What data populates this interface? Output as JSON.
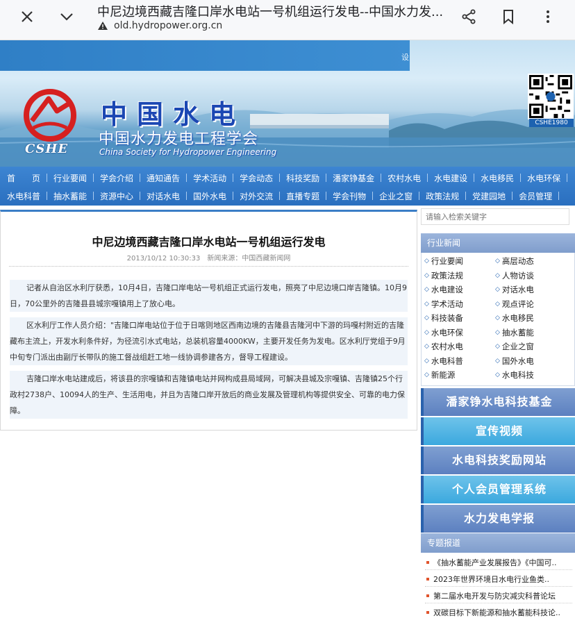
{
  "browser": {
    "title": "中尼边境西藏吉隆口岸水电站一号机组运行发电--中国水力发...",
    "url": "old.hydropower.org.cn"
  },
  "banner": {
    "strip_text": "设",
    "title_big": "中国水电",
    "title_sub": "中国水力发电工程学会",
    "title_en": "China Society for Hydropower Engineering",
    "logo_text": "CSHE",
    "qr_label": "CSHE1980"
  },
  "nav": {
    "row1": [
      "首　　页",
      "行业要闻",
      "学会介绍",
      "通知通告",
      "学术活动",
      "学会动态",
      "科技奖励",
      "潘家铮基金",
      "农村水电",
      "水电建设",
      "水电移民",
      "水电环保"
    ],
    "row2": [
      "水电科普",
      "抽水蓄能",
      "资源中心",
      "对话水电",
      "国外水电",
      "对外交流",
      "直播专题",
      "学会刊物",
      "企业之窗",
      "政策法规",
      "党建园地",
      "会员管理"
    ]
  },
  "article": {
    "title": "中尼边境西藏吉隆口岸水电站一号机组运行发电",
    "date": "2013/10/12 10:30:33",
    "source": "新闻来源：中国西藏新闻网",
    "paragraphs": [
      "记者从自治区水利厅获悉，10月4日，吉隆口岸电站一号机组正式运行发电，照亮了中尼边境口岸吉隆镇。10月9日，70公里外的吉隆县县城宗嘎镇用上了放心电。",
      "区水利厅工作人员介绍：\"吉隆口岸电站位于位于日喀则地区西南边境的吉隆县吉隆河中下游的玛嘎村附近的吉隆藏布主流上，开发水利条件好，为径流引水式电站，总装机容量4000KW，主要开发任务为发电。区水利厅党组于9月中旬专门派出由副厅长带队的施工督战组赶工地一线协调参建各方，督导工程建设。",
      "吉隆口岸水电站建成后，将该县的宗嘎镇和吉隆镇电站并网构成县局域网，可解决县城及宗嘎镇、吉隆镇25个行政村2738户、10094人的生产、生活用电，并且为吉隆口岸开放后的商业发展及管理机构等提供安全、可靠的电力保障。"
    ]
  },
  "sidebar": {
    "search_placeholder": "请输入检索关键字",
    "news_header": "行业新闻",
    "news_left": [
      "行业要闻",
      "政策法规",
      "水电建设",
      "学术活动",
      "科技装备",
      "水电环保",
      "农村水电",
      "水电科普",
      "新能源"
    ],
    "news_right": [
      "高层动态",
      "人物访谈",
      "对话水电",
      "观点评论",
      "水电移民",
      "抽水蓄能",
      "企业之窗",
      "国外水电",
      "水电科技"
    ],
    "promos": [
      "潘家铮水电科技基金",
      "宣传视频",
      "水电科技奖励网站",
      "个人会员管理系统",
      "水力发电学报"
    ],
    "topic_header": "专题报道",
    "topics": [
      "《抽水蓄能产业发展报告》《中国可..",
      "2023年世界环境日水电行业鱼类..",
      "第二届水电开发与防灾减灾科普论坛",
      "双碳目标下新能源和抽水蓄能科技论.."
    ]
  },
  "colors": {
    "nav_blue": "#2f78c8",
    "side_header": "#8aa6d2",
    "promo_cyan": "#4aaee0",
    "promo_blue": "#6a8cc7"
  }
}
